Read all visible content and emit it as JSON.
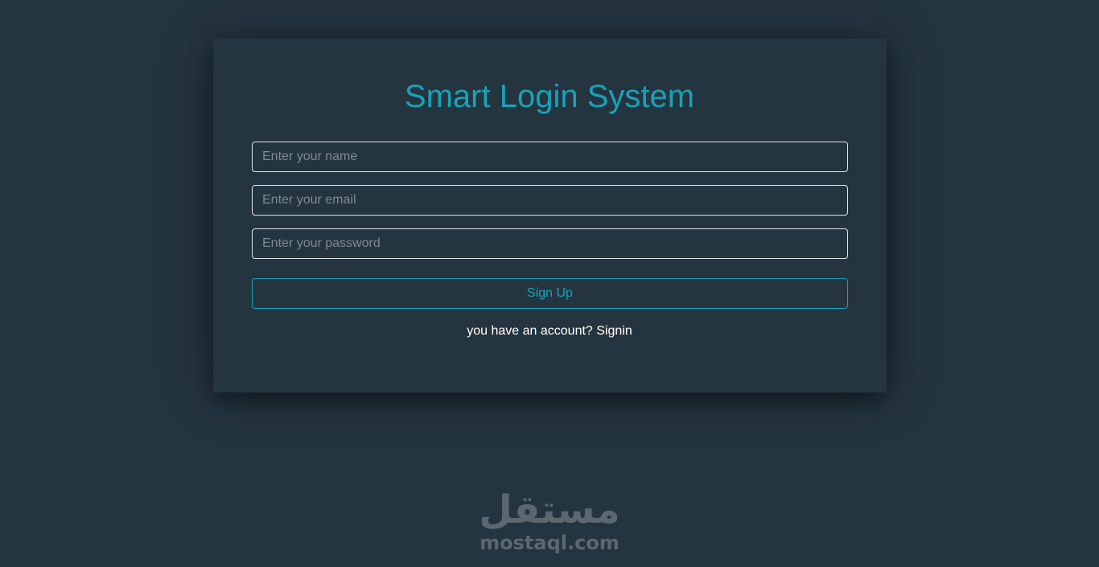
{
  "form": {
    "title": "Smart Login System",
    "name_placeholder": "Enter your name",
    "email_placeholder": "Enter your email",
    "password_placeholder": "Enter your password",
    "submit_label": "Sign Up",
    "switch_prompt": "you have an account? ",
    "switch_link": "Signin"
  },
  "watermark": {
    "arabic": "مستقل",
    "latin": "mostaql.com"
  },
  "colors": {
    "background": "#253540",
    "accent": "#17a2b8",
    "text": "#ffffff"
  }
}
